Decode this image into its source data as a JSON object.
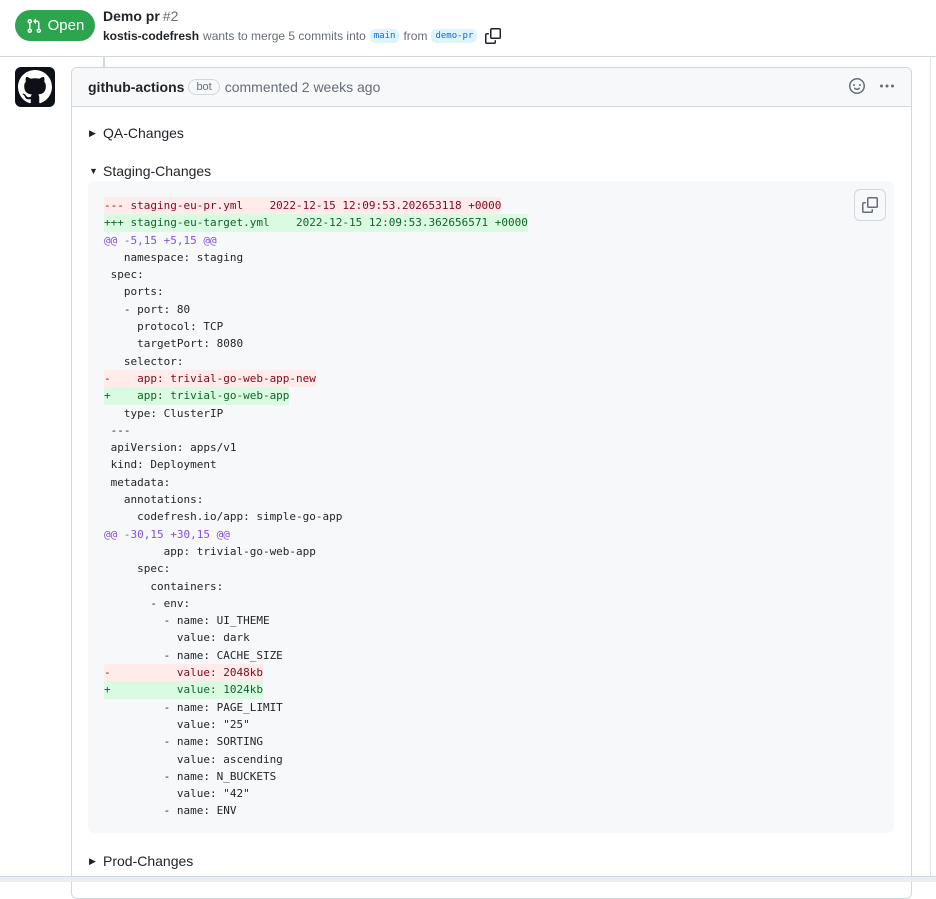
{
  "header": {
    "state_label": "Open",
    "title": "Demo pr",
    "number": "#2",
    "author": "kostis-codefresh",
    "merge_text": "wants to merge 5 commits into",
    "base_branch": "main",
    "from_text": "from",
    "head_branch": "demo-pr"
  },
  "comment": {
    "author": "github-actions",
    "badge": "bot",
    "time_text": "commented 2 weeks ago",
    "sections": {
      "qa": "QA-Changes",
      "staging": "Staging-Changes",
      "prod": "Prod-Changes"
    }
  },
  "diff_lines": [
    {
      "type": "del",
      "text": "--- staging-eu-pr.yml\t2022-12-15 12:09:53.202653118 +0000"
    },
    {
      "type": "add",
      "text": "+++ staging-eu-target.yml\t2022-12-15 12:09:53.362656571 +0000"
    },
    {
      "type": "hunk",
      "text": "@@ -5,15 +5,15 @@"
    },
    {
      "type": "ctx",
      "text": "   namespace: staging"
    },
    {
      "type": "ctx",
      "text": " spec:"
    },
    {
      "type": "ctx",
      "text": "   ports:"
    },
    {
      "type": "ctx",
      "text": "   - port: 80"
    },
    {
      "type": "ctx",
      "text": "     protocol: TCP"
    },
    {
      "type": "ctx",
      "text": "     targetPort: 8080"
    },
    {
      "type": "ctx",
      "text": "   selector:"
    },
    {
      "type": "del",
      "text": "-    app: trivial-go-web-app-new"
    },
    {
      "type": "add",
      "text": "+    app: trivial-go-web-app"
    },
    {
      "type": "ctx",
      "text": "   type: ClusterIP"
    },
    {
      "type": "ctx",
      "text": " ---"
    },
    {
      "type": "ctx",
      "text": " apiVersion: apps/v1"
    },
    {
      "type": "ctx",
      "text": " kind: Deployment"
    },
    {
      "type": "ctx",
      "text": " metadata:"
    },
    {
      "type": "ctx",
      "text": "   annotations:"
    },
    {
      "type": "ctx",
      "text": "     codefresh.io/app: simple-go-app"
    },
    {
      "type": "hunk",
      "text": "@@ -30,15 +30,15 @@"
    },
    {
      "type": "ctx",
      "text": "         app: trivial-go-web-app"
    },
    {
      "type": "ctx",
      "text": "     spec:"
    },
    {
      "type": "ctx",
      "text": "       containers:"
    },
    {
      "type": "ctx",
      "text": "       - env:"
    },
    {
      "type": "ctx",
      "text": "         - name: UI_THEME"
    },
    {
      "type": "ctx",
      "text": "           value: dark"
    },
    {
      "type": "ctx",
      "text": "         - name: CACHE_SIZE"
    },
    {
      "type": "del",
      "text": "-          value: 2048kb"
    },
    {
      "type": "add",
      "text": "+          value: 1024kb"
    },
    {
      "type": "ctx",
      "text": "         - name: PAGE_LIMIT"
    },
    {
      "type": "ctx",
      "text": "           value: \"25\""
    },
    {
      "type": "ctx",
      "text": "         - name: SORTING"
    },
    {
      "type": "ctx",
      "text": "           value: ascending"
    },
    {
      "type": "ctx",
      "text": "         - name: N_BUCKETS"
    },
    {
      "type": "ctx",
      "text": "           value: \"42\""
    },
    {
      "type": "ctx",
      "text": "         - name: ENV"
    }
  ],
  "colors": {
    "open_green": "#2da44e",
    "del_bg": "#ffebe9",
    "add_bg": "#dafbe1",
    "hunk": "#8250df"
  }
}
